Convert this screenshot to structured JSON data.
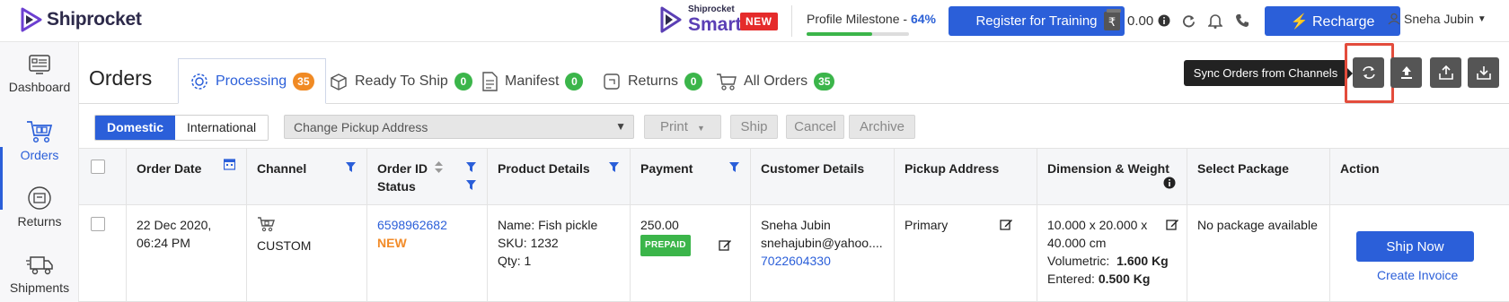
{
  "header": {
    "brand": "Shiprocket",
    "smart_sub": "Shiprocket",
    "smart_main": "Smart",
    "new_badge": "NEW",
    "milestone_label": "Profile Milestone - ",
    "milestone_value": "64%",
    "milestone_progress": 0.64,
    "training_button": "Register for Training",
    "wallet_amount": "0.00",
    "recharge_button": "Recharge",
    "user_name": "Sneha Jubin"
  },
  "sidebar": {
    "items": [
      {
        "label": "Dashboard"
      },
      {
        "label": "Orders",
        "active": true
      },
      {
        "label": "Returns"
      },
      {
        "label": "Shipments"
      }
    ]
  },
  "page": {
    "title": "Orders",
    "tabs": [
      {
        "label": "Processing",
        "count": "35",
        "color": "#f08a24",
        "active": true
      },
      {
        "label": "Ready To Ship",
        "count": "0",
        "color": "#3bb54a"
      },
      {
        "label": "Manifest",
        "count": "0",
        "color": "#3bb54a"
      },
      {
        "label": "Returns",
        "count": "0",
        "color": "#3bb54a"
      },
      {
        "label": "All Orders",
        "count": "35",
        "color": "#3bb54a"
      }
    ],
    "tooltip": "Sync Orders from Channels"
  },
  "filters": {
    "domestic": "Domestic",
    "international": "International",
    "pickup_select": "Change Pickup Address",
    "print": "Print",
    "ship": "Ship",
    "cancel": "Cancel",
    "archive": "Archive"
  },
  "table": {
    "headers": {
      "order_date": "Order Date",
      "channel": "Channel",
      "order_id": "Order ID",
      "status": "Status",
      "product_details": "Product Details",
      "payment": "Payment",
      "customer_details": "Customer Details",
      "pickup_address": "Pickup Address",
      "dimension_weight": "Dimension & Weight",
      "select_package": "Select Package",
      "action": "Action"
    },
    "rows": [
      {
        "date_line1": "22 Dec 2020,",
        "date_line2": "06:24 PM",
        "channel": "CUSTOM",
        "order_id": "6598962682",
        "status": "NEW",
        "product_name": "Name: Fish pickle",
        "product_sku": "SKU: 1232",
        "product_qty": "Qty: 1",
        "amount": "250.00",
        "payment_mode": "PREPAID",
        "customer_name": "Sneha Jubin",
        "customer_email": "snehajubin@yahoo....",
        "customer_phone": "7022604330",
        "pickup": "Primary",
        "dim_line1": "10.000 x 20.000 x",
        "dim_line2": "40.000 cm",
        "volumetric_label": "Volumetric:",
        "volumetric_value": "1.600 Kg",
        "entered_label": "Entered:",
        "entered_value": "0.500 Kg",
        "package": "No package available",
        "ship_now": "Ship Now",
        "create_invoice": "Create Invoice"
      }
    ]
  },
  "colors": {
    "primary": "#2b5fd9",
    "badge_orange": "#f08a24",
    "badge_green": "#3bb54a",
    "new_red": "#e52b2b",
    "highlight": "#e34c3c"
  }
}
